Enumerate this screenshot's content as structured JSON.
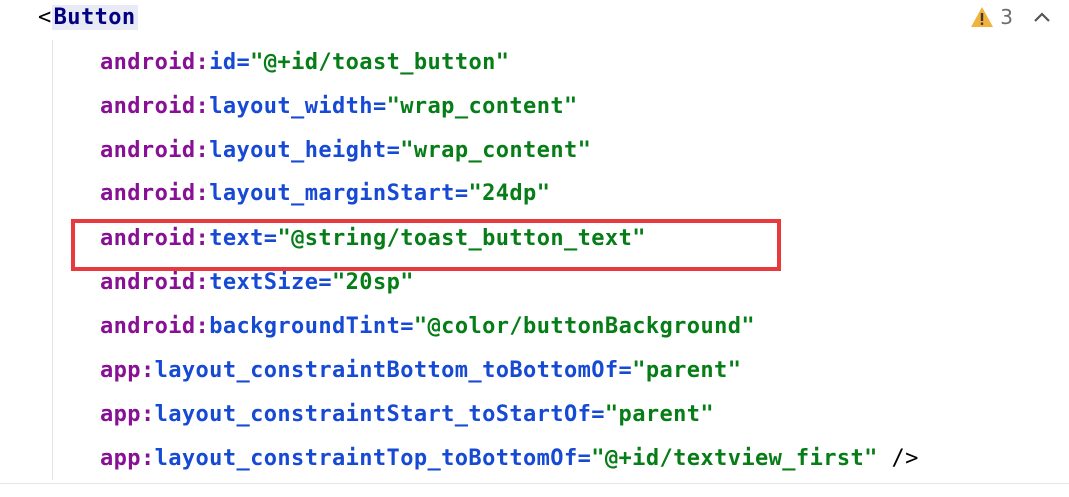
{
  "editor": {
    "open_bracket": "<",
    "tag": "Button",
    "close_tag": "/>",
    "inspection": {
      "warning_count": "3",
      "icon": "warning-icon",
      "collapse_icon": "chevron-up-icon"
    },
    "lines": [
      {
        "ns": "android",
        "attr": "id",
        "value": "\"@+id/toast_button\""
      },
      {
        "ns": "android",
        "attr": "layout_width",
        "value": "\"wrap_content\""
      },
      {
        "ns": "android",
        "attr": "layout_height",
        "value": "\"wrap_content\""
      },
      {
        "ns": "android",
        "attr": "layout_marginStart",
        "value": "\"24dp\""
      },
      {
        "ns": "android",
        "attr": "text",
        "value": "\"@string/toast_button_text\""
      },
      {
        "ns": "android",
        "attr": "textSize",
        "value": "\"20sp\""
      },
      {
        "ns": "android",
        "attr": "backgroundTint",
        "value": "\"@color/buttonBackground\""
      },
      {
        "ns": "app",
        "attr": "layout_constraintBottom_toBottomOf",
        "value": "\"parent\""
      },
      {
        "ns": "app",
        "attr": "layout_constraintStart_toStartOf",
        "value": "\"parent\""
      },
      {
        "ns": "app",
        "attr": "layout_constraintTop_toBottomOf",
        "value": "\"@+id/textview_first\""
      }
    ],
    "highlight_color": "#e8393f"
  }
}
